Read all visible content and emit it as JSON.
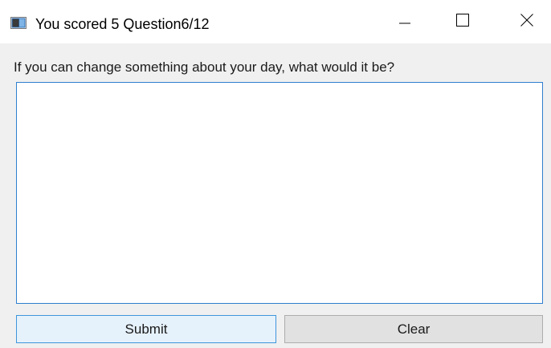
{
  "window": {
    "title": "You scored 5 Question6/12",
    "icon": "app-window-icon",
    "controls": {
      "minimize_icon": "minimize-icon",
      "maximize_icon": "maximize-icon",
      "close_icon": "close-icon"
    }
  },
  "form": {
    "question": "If you can change something about your day, what would it be?",
    "answer_value": "",
    "submit_label": "Submit",
    "clear_label": "Clear"
  },
  "colors": {
    "accent_border": "#2f7fcf",
    "submit_bg": "#e5f1fb",
    "clear_bg": "#e1e1e1",
    "client_bg": "#f0f0f0"
  }
}
